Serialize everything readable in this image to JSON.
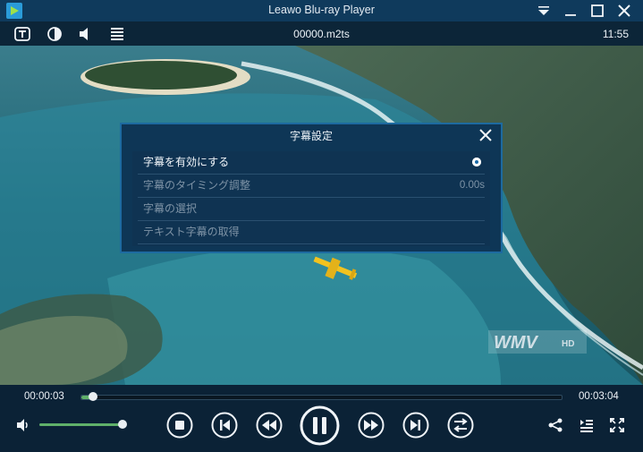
{
  "window": {
    "title": "Leawo Blu-ray Player"
  },
  "toolbar": {
    "file_name": "00000.m2ts",
    "clock": "11:55",
    "icons": [
      "subtitle-icon",
      "contrast-icon",
      "volume-icon",
      "playlist-icon"
    ]
  },
  "video": {
    "watermark": "WMV HD"
  },
  "subtitle_dialog": {
    "title": "字幕設定",
    "options": [
      {
        "label": "字幕を有効にする",
        "value": "",
        "state": "enabled"
      },
      {
        "label": "字幕のタイミング調整",
        "value": "0.00s",
        "state": "disabled"
      },
      {
        "label": "字幕の選択",
        "value": "",
        "state": "disabled"
      },
      {
        "label": "テキスト字幕の取得",
        "value": "",
        "state": "disabled"
      }
    ]
  },
  "playback": {
    "current_time": "00:00:03",
    "total_time": "00:03:04",
    "progress_fraction": 0.025,
    "volume_fraction": 1.0
  },
  "colors": {
    "accent_green": "#5fb06a",
    "title_bar": "#0f3a5c",
    "dialog_bg": "#0e3656",
    "dialog_border": "#1d6aa0"
  }
}
